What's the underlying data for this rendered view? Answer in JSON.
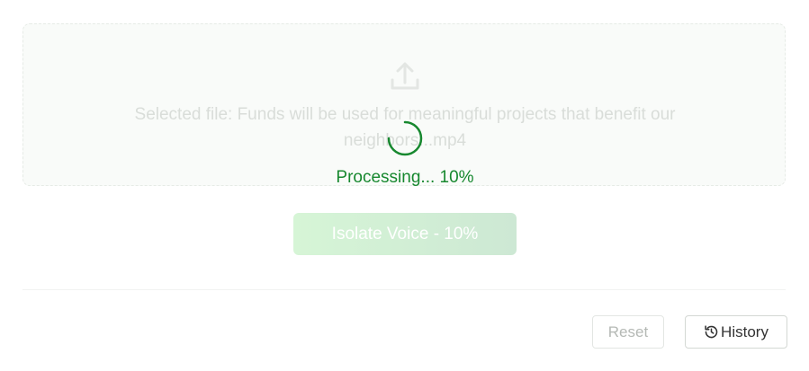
{
  "upload": {
    "icon": "upload-icon",
    "selected_file_text": "Selected file: Funds will be used for meaningful projects that benefit our neighbors...mp4"
  },
  "progress": {
    "status_text": "Processing... 10%",
    "percent": 10,
    "spinner_icon": "spinner-icon"
  },
  "actions": {
    "isolate_label": "Isolate Voice - 10%",
    "reset_label": "Reset",
    "history_label": "History",
    "history_icon": "history-icon"
  },
  "colors": {
    "accent": "#17882f",
    "button_gradient_start": "#d6f5d6",
    "button_gradient_end": "#cde8d4"
  }
}
